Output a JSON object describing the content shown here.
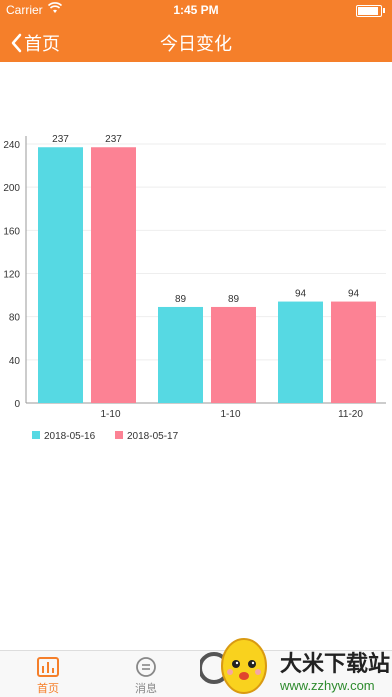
{
  "status_bar": {
    "carrier": "Carrier",
    "time": "1:45 PM"
  },
  "nav": {
    "back_label": "首页",
    "title": "今日变化"
  },
  "chart_data": {
    "type": "bar",
    "categories": [
      "1-10",
      "1-10",
      "11-20"
    ],
    "series": [
      {
        "name": "2018-05-16",
        "values": [
          237,
          89,
          94
        ],
        "color": "#56d9e3"
      },
      {
        "name": "2018-05-17",
        "values": [
          237,
          89,
          94
        ],
        "color": "#fc8294"
      }
    ],
    "yticks": [
      "0",
      "40",
      "80",
      "120",
      "160",
      "200",
      "240"
    ],
    "ylim": [
      0,
      240
    ],
    "legend": "bottom-left",
    "grid": true
  },
  "tabbar": {
    "home_label": "首页",
    "messages_label": "消息"
  },
  "watermark": {
    "text": "大米下载站",
    "url": "www.zzhyw.com"
  }
}
